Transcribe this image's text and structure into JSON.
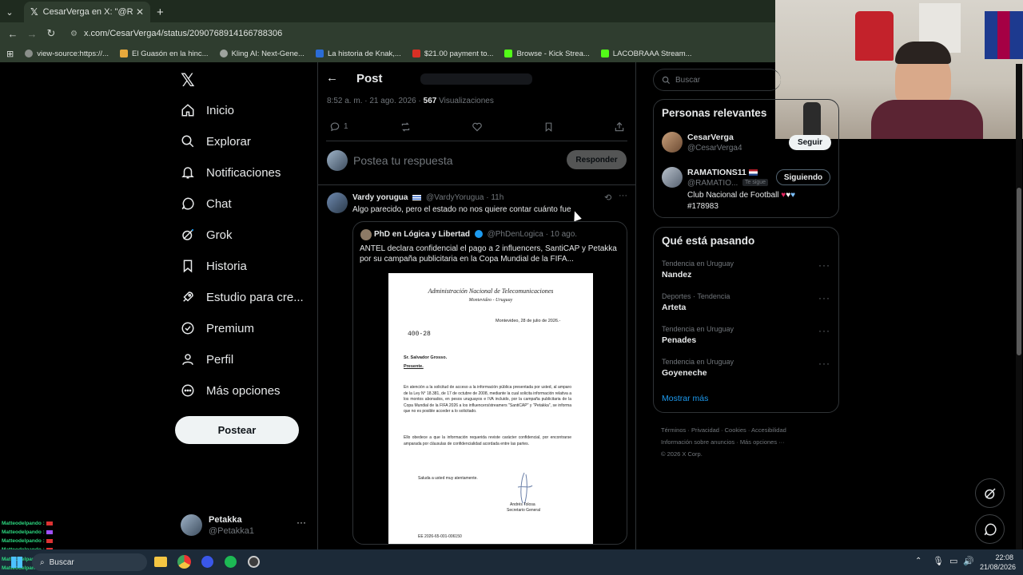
{
  "browser": {
    "tab_title": "CesarVerga en X: \"@RAMATION",
    "address": "x.com/CesarVerga4/status/2090768914166788306",
    "bookmarks": [
      {
        "label": "view-source:https://...",
        "color": "#8a8f8a"
      },
      {
        "label": "El Guasón en la hinc...",
        "color": "#e7a93c"
      },
      {
        "label": "Kling AI: Next-Gene...",
        "color": "#9ea39e"
      },
      {
        "label": "La historia de Knak,...",
        "color": "#2b6cd6"
      },
      {
        "label": "$21.00 payment to...",
        "color": "#d93025"
      },
      {
        "label": "Browse - Kick Strea...",
        "color": "#53fc18"
      },
      {
        "label": "LACOBRAAA Stream...",
        "color": "#53fc18"
      }
    ]
  },
  "nav": {
    "items": [
      {
        "label": "Inicio",
        "icon": "home-icon"
      },
      {
        "label": "Explorar",
        "icon": "search-icon"
      },
      {
        "label": "Notificaciones",
        "icon": "bell-icon"
      },
      {
        "label": "Chat",
        "icon": "chat-icon"
      },
      {
        "label": "Grok",
        "icon": "grok-icon"
      },
      {
        "label": "Historia",
        "icon": "bookmark-icon"
      },
      {
        "label": "Estudio para cre...",
        "icon": "rocket-icon"
      },
      {
        "label": "Premium",
        "icon": "verified-icon"
      },
      {
        "label": "Perfil",
        "icon": "person-icon"
      },
      {
        "label": "Más opciones",
        "icon": "more-circle-icon"
      }
    ],
    "post_button": "Postear",
    "account": {
      "name": "Petakka",
      "handle": "@Petakka1"
    }
  },
  "post": {
    "header": "Post",
    "meta_time": "8:52 a. m. · 21 ago. 2026 · ",
    "views_count": "567",
    "views_label": " Visualizaciones",
    "reply_count": "1",
    "reply_placeholder": "Postea tu respuesta",
    "reply_button": "Responder"
  },
  "reply": {
    "author": "Vardy yorugua",
    "handle": "@VardyYorugua",
    "time": "· 11h",
    "text": "Algo parecido, pero el estado no nos quiere contar cuánto fue",
    "quote": {
      "author": "PhD en Lógica y Libertad",
      "handle": "@PhDenLogica",
      "time": "· 10 ago.",
      "text": "ANTEL declara confidencial el pago a 2 influencers, SantiCAP y Petakka por su campaña publicitaria en la Copa Mundial de la FIFA...",
      "doc": {
        "org": "Administración Nacional de Telecomunicaciones",
        "city": "Montevideo - Uruguay",
        "date": "Montevideo, 28 de julio de 2026.-",
        "ref": "400-28",
        "addressee": "Sr. Salvador Grosso.",
        "presente": "Presente.",
        "p1": "En atención a la solicitud de acceso a la información pública presentada por usted, al amparo de la Ley N° 18.381, de 17 de octubre de 2008, mediante la cual solicita información relativa a los montos abonados, en pesos uruguayos e IVA incluido, por la campaña publicitaria de la Copa Mundial de la FIFA 2026 a los influencers/streamers \"SantiCAP\" y \"Petakka\", se informa que no es posible acceder a lo solicitado.",
        "p2": "Ello obedece a que la información requerida reviste carácter confidencial, por encontrarse amparada por cláusulas de confidencialidad acordada entre las partes.",
        "closing": "Saluda a usted muy atentamente.",
        "signer": "Andrés Tolosa",
        "signer_title": "Secretario General",
        "footer": "EE 2026-65-001-006150"
      }
    }
  },
  "sidebar": {
    "search_placeholder": "Buscar",
    "relevant_title": "Personas relevantes",
    "people": [
      {
        "name": "CesarVerga",
        "handle": "@CesarVerga4",
        "button": "Seguir"
      },
      {
        "name": "RAMATIONS11",
        "handle": "@RAMATIO...",
        "badge": "Te sigue",
        "button": "Siguiendo",
        "bio": "Club Nacional de Football",
        "bio2": "#178983"
      }
    ],
    "trends_title": "Qué está pasando",
    "trends": [
      {
        "context": "Tendencia en Uruguay",
        "name": "Nandez"
      },
      {
        "context": "Deportes · Tendencia",
        "name": "Arteta"
      },
      {
        "context": "Tendencia en Uruguay",
        "name": "Penades"
      },
      {
        "context": "Tendencia en Uruguay",
        "name": "Goyeneche"
      }
    ],
    "show_more": "Mostrar más",
    "footer_line1": [
      "Términos",
      "Privacidad",
      "Cookies",
      "Accesibilidad"
    ],
    "footer_line2": [
      "Información sobre anuncios",
      "Más opciones ···"
    ],
    "copyright": "© 2026 X Corp."
  },
  "chat_overlay": {
    "user": "Matteodelpando :",
    "count": 7
  },
  "taskbar": {
    "search": "Buscar",
    "time": "22:08",
    "date": "21/08/2026"
  },
  "colors": {
    "accent": "#1d9bf0",
    "green_kick": "#53fc18"
  }
}
